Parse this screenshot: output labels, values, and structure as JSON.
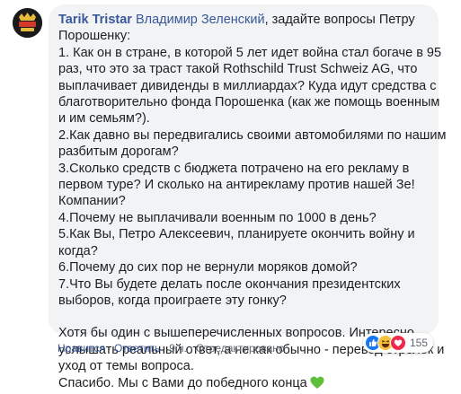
{
  "comment": {
    "author": "Tarik Tristar",
    "mention": "Владимир Зеленский",
    "lines": [
      ", задайте вопросы Петру",
      "Порошенку:",
      "1. Как он в стране, в которой 5 лет идет война стал богаче в 95",
      "раз, что это за траст такой Rothschild Trust Schweiz AG, что",
      "выплачивает дивиденды в миллиардах? Куда идут средства с",
      "благотворительно фонда Порошенка (как же помощь военным",
      "и им семьям?).",
      "2.Как давно вы передвигались своими автомобилями по нашим",
      "разбитым дорогам?",
      "3.Сколько средств с бюджета потрачено на его рекламу в",
      "первом туре? И сколько на антирекламу против нашей Зе!",
      "Компании?",
      "4.Почему не выплачивали военным по 1000 в день?",
      "5.Как Вы, Петро Алексеевич, планируете окончить войну и",
      "когда?",
      "6.Почему до сих пор не вернули моряков домой?",
      "7.Что Вы будете делать после окончания президентских",
      "выборов, когда проиграете эту гонку?",
      "",
      "Хотя бы один с вышеперечисленных вопросов. Интересно",
      "услышать реальный ответ, а не как обычно - перевод стрелок и",
      "уход от темы вопроса.",
      "Спасибо. Мы с Вами до победного конца"
    ]
  },
  "actions": {
    "like": "Нравится",
    "reply": "Ответить",
    "time": "9 ч.",
    "edited": "Отредактировано",
    "sep": "·"
  },
  "reactions": {
    "count": "155",
    "icons": [
      "like-icon",
      "haha-icon",
      "love-icon"
    ]
  },
  "colors": {
    "link": "#385898",
    "bubble": "#f2f3f5",
    "heart": "#5fbf3a"
  }
}
